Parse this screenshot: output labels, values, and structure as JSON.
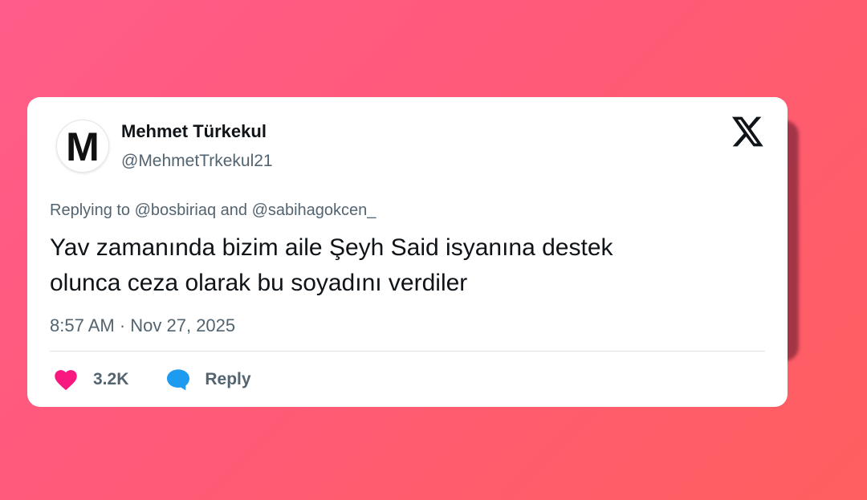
{
  "colors": {
    "background_start": "#ff5c8a",
    "background_end": "#ff5f5f",
    "card": "#ffffff",
    "text_primary": "#0f1419",
    "text_secondary": "#536471",
    "heart": "#f91880",
    "reply_bubble": "#1d9bf0"
  },
  "tweet": {
    "author": {
      "avatar_letter": "M",
      "display_name": "Mehmet Türkekul",
      "handle": "@MehmetTrkekul21"
    },
    "platform_icon": "x-logo-icon",
    "replying_to": "Replying to @bosbiriaq and @sabihagokcen_",
    "text_line1": "Yav zamanında bizim aile Şeyh Said isyanına destek",
    "text_line2": "olunca ceza olarak bu soyadını verdiler",
    "timestamp": "8:57 AM · Nov 27, 2025",
    "actions": {
      "like_icon": "heart-icon",
      "like_count": "3.2K",
      "reply_icon": "speech-bubble-icon",
      "reply_label": "Reply"
    }
  }
}
